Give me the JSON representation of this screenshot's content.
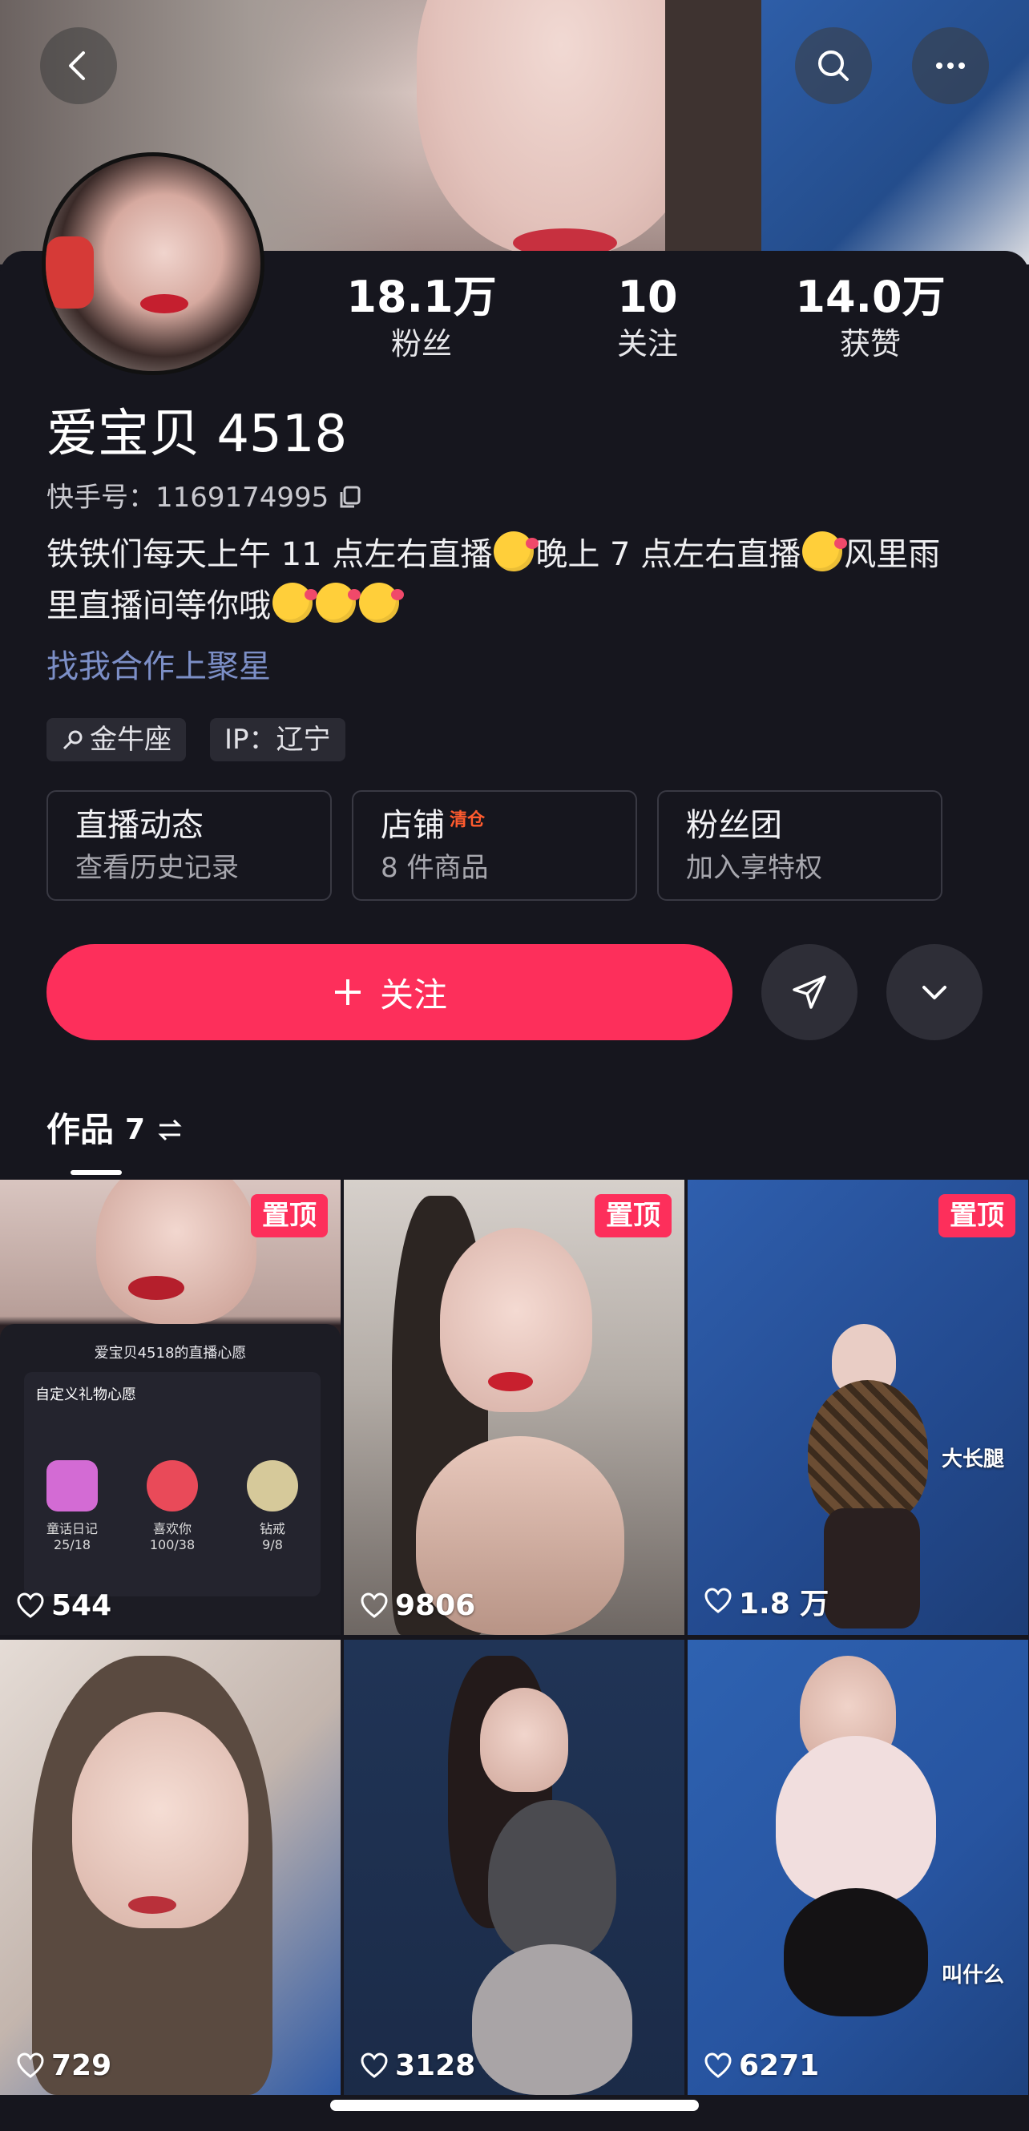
{
  "header": {
    "back_icon": "back-arrow-icon",
    "search_icon": "search-icon",
    "more_icon": "more-dots-icon"
  },
  "profile": {
    "stats": [
      {
        "value": "18.1万",
        "label": "粉丝"
      },
      {
        "value": "10",
        "label": "关注"
      },
      {
        "value": "14.0万",
        "label": "获赞"
      }
    ],
    "name": "爱宝贝 4518",
    "kuaishou_id": "快手号：1169174995",
    "bio_1": "铁铁们每天上午 11 点左右直播",
    "bio_2": "晚上 7 点左右直播",
    "bio_3": "风里雨",
    "bio_4": "里直播间等你哦",
    "link": "找我合作上聚星",
    "tags": [
      "金牛座",
      "IP：辽宁"
    ]
  },
  "cards": [
    {
      "title": "直播动态",
      "badge": "",
      "sub": "查看历史记录"
    },
    {
      "title": "店铺",
      "badge": "清仓",
      "sub": "8 件商品"
    },
    {
      "title": "粉丝团",
      "badge": "",
      "sub": "加入享特权"
    }
  ],
  "actions": {
    "follow_label": "关注",
    "share_icon": "send-icon",
    "dropdown_icon": "chevron-down-icon"
  },
  "tabs": {
    "works_label": "作品",
    "works_count": "7"
  },
  "videos": [
    {
      "likes": "544",
      "pinned": "置顶",
      "caption": ""
    },
    {
      "likes": "9806",
      "pinned": "置顶",
      "caption": ""
    },
    {
      "likes": "1.8 万",
      "pinned": "置顶",
      "caption": "大长腿"
    },
    {
      "likes": "729",
      "pinned": "",
      "caption": ""
    },
    {
      "likes": "3128",
      "pinned": "",
      "caption": ""
    },
    {
      "likes": "6271",
      "pinned": "",
      "caption": "叫什么"
    }
  ],
  "tile1_panel": {
    "title": "爱宝贝4518的直播心愿",
    "subtitle": "自定义礼物心愿",
    "gifts": [
      {
        "name": "童话日记",
        "progress": "25/18"
      },
      {
        "name": "喜欢你",
        "progress": "100/38"
      },
      {
        "name": "钻戒",
        "progress": "9/8"
      }
    ]
  },
  "colors": {
    "accent": "#fd2f5b",
    "link": "#7c8fc7",
    "background": "#16161e"
  }
}
